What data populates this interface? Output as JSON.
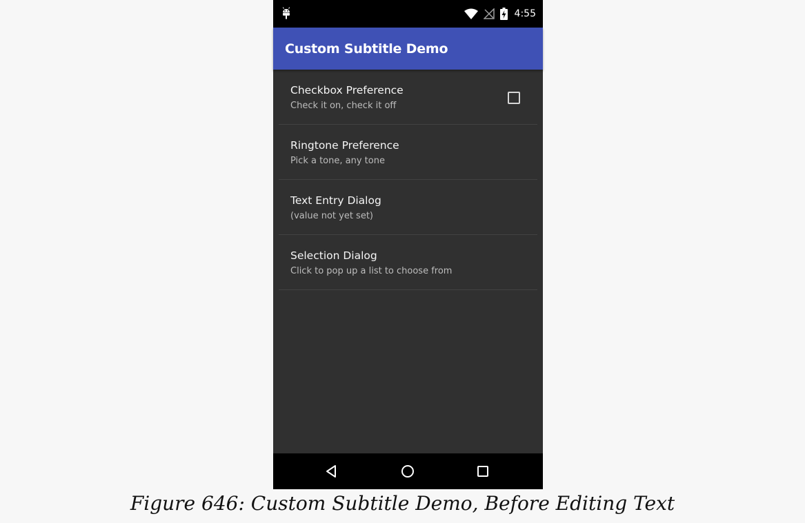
{
  "status_bar": {
    "time": "4:55",
    "icons": [
      "android-debug-icon",
      "wifi-icon",
      "no-signal-icon",
      "battery-charging-icon"
    ]
  },
  "app_bar": {
    "title": "Custom Subtitle Demo",
    "color": "#3f51b5"
  },
  "preferences": [
    {
      "title": "Checkbox Preference",
      "summary": "Check it on, check it off",
      "has_checkbox": true,
      "checked": false
    },
    {
      "title": "Ringtone Preference",
      "summary": "Pick a tone, any tone"
    },
    {
      "title": "Text Entry Dialog",
      "summary": "(value not yet set)"
    },
    {
      "title": "Selection Dialog",
      "summary": "Click to pop up a list to choose from"
    }
  ],
  "nav_bar": {
    "buttons": [
      "back-icon",
      "home-icon",
      "recents-icon"
    ]
  },
  "caption": "Figure 646: Custom Subtitle Demo, Before Editing Text"
}
